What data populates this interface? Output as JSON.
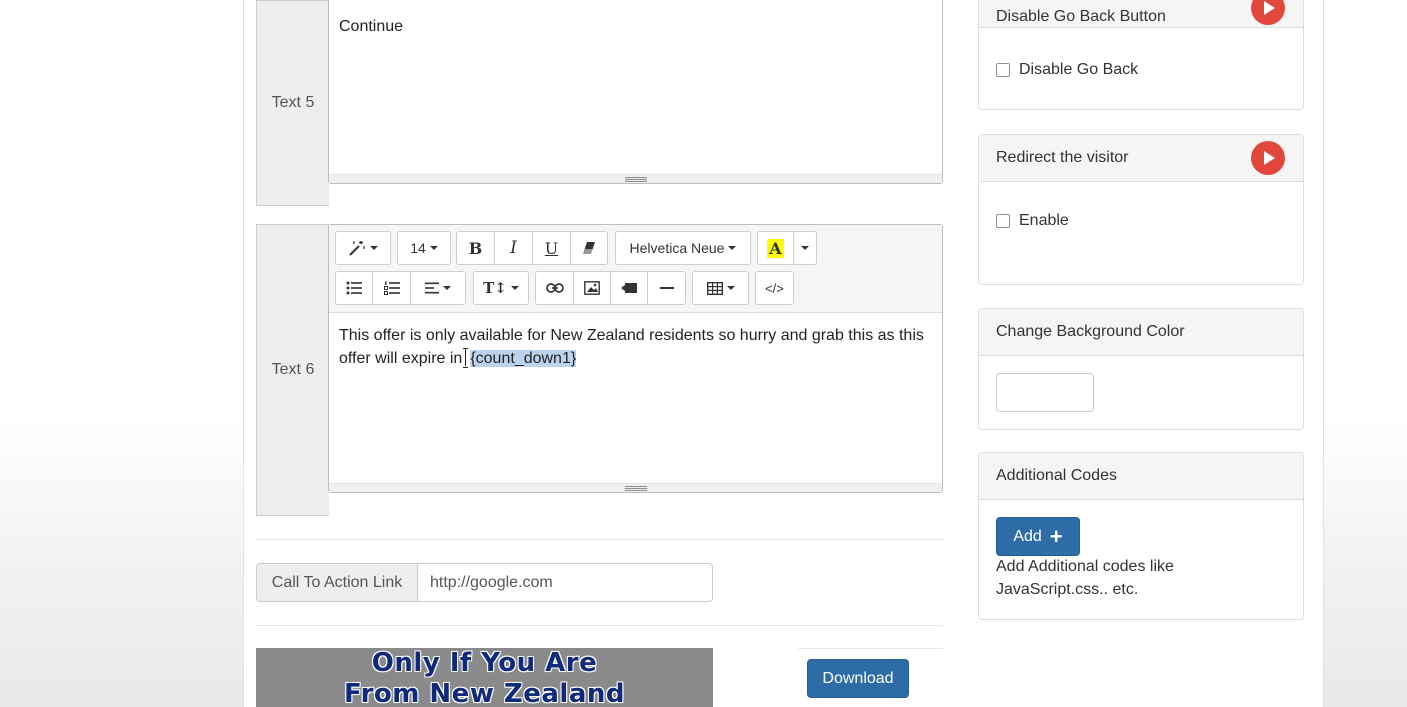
{
  "text5": {
    "label": "Text 5",
    "content": "Continue"
  },
  "text6": {
    "label": "Text 6",
    "toolbar": {
      "magic": "magic-wand-icon",
      "font_size": "14",
      "bold": "B",
      "italic": "I",
      "underline": "U",
      "font_family": "Helvetica Neue",
      "color_letter": "A",
      "line_height": "T↕",
      "code": "</>"
    },
    "content_before": "This offer is only available for New Zealand residents so hurry and grab this as this offer will expire in",
    "content_highlight": "{count_down1}"
  },
  "cta": {
    "label": "Call To Action Link",
    "value": "http://google.com"
  },
  "banner": {
    "line1": "Only If You Are",
    "line2": "From New Zealand"
  },
  "download_label": "Download",
  "panels": {
    "go_back": {
      "title": "Disable Go Back Button",
      "checkbox_label": "Disable Go Back"
    },
    "redirect": {
      "title": "Redirect the visitor",
      "checkbox_label": "Enable"
    },
    "bg_color": {
      "title": "Change Background Color",
      "value": ""
    },
    "additional": {
      "title": "Additional Codes",
      "add_label": "Add",
      "add_icon": "+",
      "note": "Add Additional codes like JavaScript.css.. etc."
    }
  },
  "colors": {
    "primary": "#2e6ca8",
    "play": "#e2473c",
    "highlight": "#bcd3ee",
    "highlight_letter_bg": "#ffff00"
  }
}
